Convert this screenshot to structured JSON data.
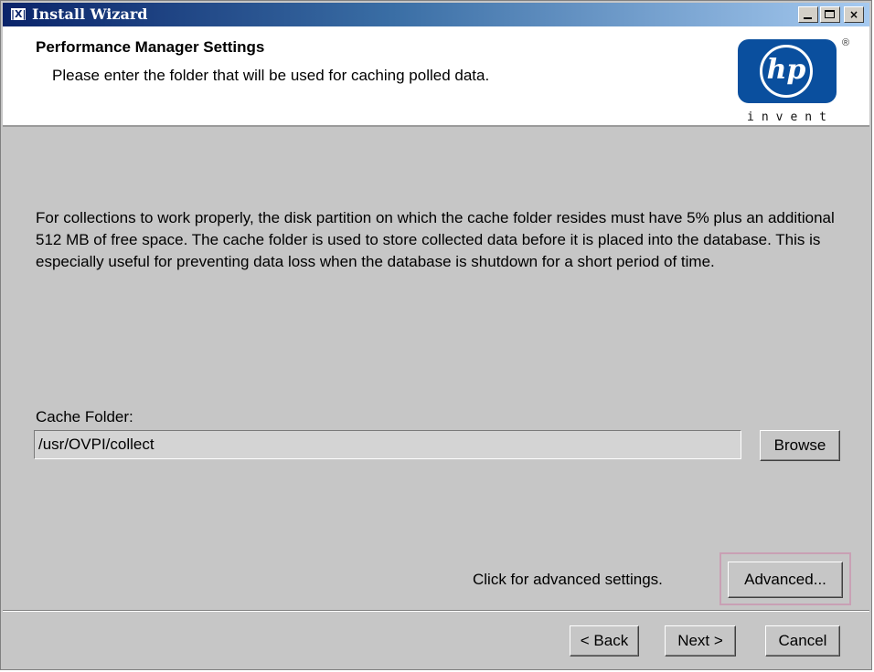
{
  "window": {
    "title": "Install Wizard",
    "icon_glyph": "|X|",
    "controls": {
      "minimize": "minimize",
      "maximize": "maximize",
      "close": "×"
    }
  },
  "header": {
    "title": "Performance Manager Settings",
    "subtitle": "Please enter the folder that will be used for caching polled data.",
    "logo": {
      "mark": "hp",
      "tagline": "invent",
      "registered": "®",
      "color": "#0a4f9e"
    }
  },
  "body": {
    "description": "For collections to work properly, the disk partition on which the cache folder resides must have 5% plus an additional 512 MB of free space. The cache folder is used to store collected data before it is placed into the database. This is especially useful for preventing data loss when the database is shutdown for a short period of time.",
    "cache_folder": {
      "label": "Cache Folder:",
      "value": "/usr/OVPI/collect",
      "browse_label": "Browse"
    },
    "advanced": {
      "prompt": "Click for advanced settings.",
      "button_label": "Advanced..."
    }
  },
  "footer": {
    "back_label": "< Back",
    "next_label": "Next >",
    "cancel_label": "Cancel"
  }
}
